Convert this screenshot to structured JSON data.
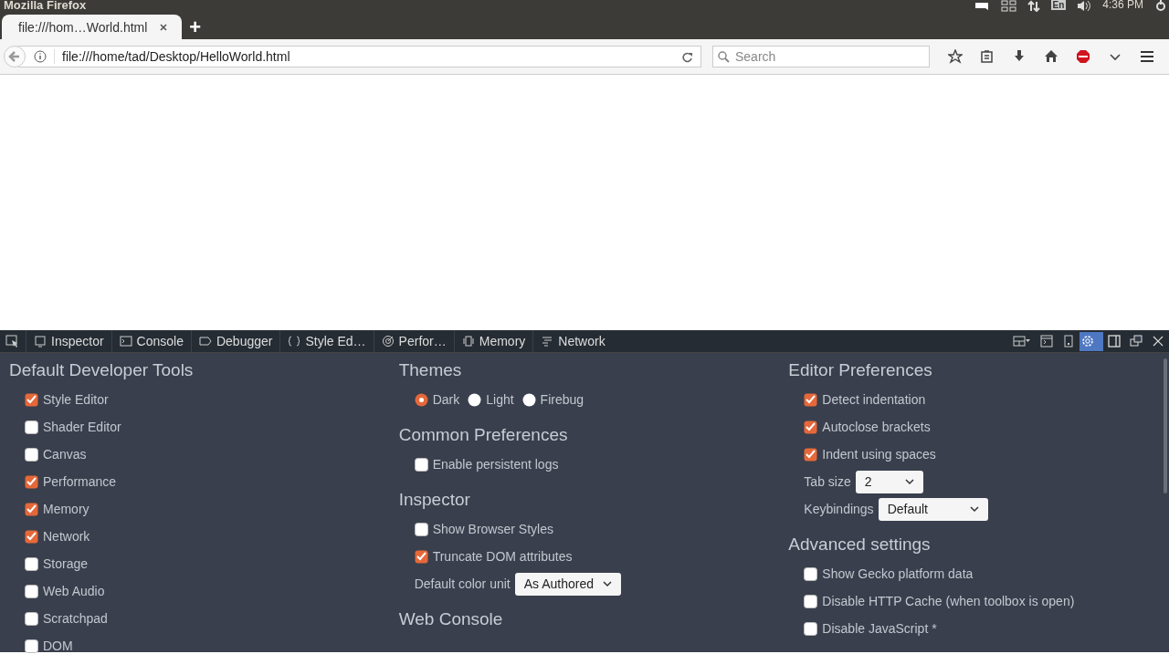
{
  "window": {
    "title": "Mozilla Firefox"
  },
  "top_panel": {
    "keyboard": "En",
    "clock": "4:36 PM"
  },
  "tabs": [
    {
      "label": "file:///hom…World.html",
      "selected": true
    }
  ],
  "new_tab": "+",
  "address_bar": {
    "value": "file:///home/tad/Desktop/HelloWorld.html"
  },
  "search": {
    "placeholder": "Search"
  },
  "devtools": {
    "tabs": [
      {
        "label": "Inspector",
        "selected": false
      },
      {
        "label": "Console",
        "selected": false
      },
      {
        "label": "Debugger",
        "selected": false
      },
      {
        "label": "Style Ed…",
        "selected": false
      },
      {
        "label": "Perfor…",
        "selected": false
      },
      {
        "label": "Memory",
        "selected": false
      },
      {
        "label": "Network",
        "selected": false
      }
    ],
    "settings_selected": true,
    "columns": [
      [
        {
          "heading": "Default Developer Tools",
          "items": [
            {
              "kind": "checkbox",
              "label": "Style Editor",
              "checked": true
            },
            {
              "kind": "checkbox",
              "label": "Shader Editor",
              "checked": false
            },
            {
              "kind": "checkbox",
              "label": "Canvas",
              "checked": false
            },
            {
              "kind": "checkbox",
              "label": "Performance",
              "checked": true
            },
            {
              "kind": "checkbox",
              "label": "Memory",
              "checked": true
            },
            {
              "kind": "checkbox",
              "label": "Network",
              "checked": true
            },
            {
              "kind": "checkbox",
              "label": "Storage",
              "checked": false
            },
            {
              "kind": "checkbox",
              "label": "Web Audio",
              "checked": false
            },
            {
              "kind": "checkbox",
              "label": "Scratchpad",
              "checked": false
            },
            {
              "kind": "checkbox",
              "label": "DOM",
              "checked": false
            }
          ]
        }
      ],
      [
        {
          "heading": "Themes",
          "items": [
            {
              "kind": "radios",
              "options": [
                {
                  "label": "Dark",
                  "selected": true
                },
                {
                  "label": "Light",
                  "selected": false
                },
                {
                  "label": "Firebug",
                  "selected": false
                }
              ]
            }
          ]
        },
        {
          "heading": "Common Preferences",
          "items": [
            {
              "kind": "checkbox",
              "label": "Enable persistent logs",
              "checked": false
            }
          ]
        },
        {
          "heading": "Inspector",
          "items": [
            {
              "kind": "checkbox",
              "label": "Show Browser Styles",
              "checked": false
            },
            {
              "kind": "checkbox",
              "label": "Truncate DOM attributes",
              "checked": true
            },
            {
              "kind": "select",
              "label": "Default color unit",
              "value": "As Authored"
            }
          ]
        },
        {
          "heading": "Web Console"
        }
      ],
      [
        {
          "heading": "Editor Preferences",
          "items": [
            {
              "kind": "checkbox",
              "label": "Detect indentation",
              "checked": true
            },
            {
              "kind": "checkbox",
              "label": "Autoclose brackets",
              "checked": true
            },
            {
              "kind": "checkbox",
              "label": "Indent using spaces",
              "checked": true
            },
            {
              "kind": "select",
              "label": "Tab size",
              "value": "2"
            },
            {
              "kind": "select",
              "label": "Keybindings",
              "value": "Default"
            }
          ]
        },
        {
          "heading": "Advanced settings",
          "items": [
            {
              "kind": "checkbox",
              "label": "Show Gecko platform data",
              "checked": false
            },
            {
              "kind": "checkbox",
              "label": "Disable HTTP Cache (when toolbox is open)",
              "checked": false
            },
            {
              "kind": "checkbox",
              "label": "Disable JavaScript *",
              "checked": false
            }
          ]
        }
      ]
    ]
  }
}
